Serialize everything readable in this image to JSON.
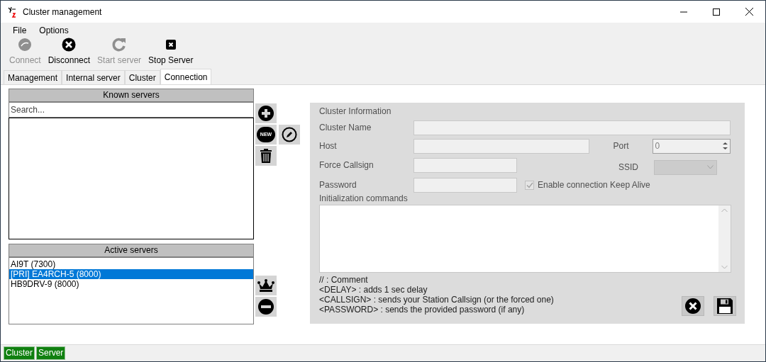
{
  "window": {
    "title": "Cluster management"
  },
  "menu": [
    "File",
    "Options"
  ],
  "toolbar": [
    {
      "label": "Connect",
      "kind": "connect",
      "disabled": true
    },
    {
      "label": "Disconnect",
      "kind": "disconnect",
      "disabled": false
    },
    {
      "label": "Start server",
      "kind": "start",
      "disabled": true
    },
    {
      "label": "Stop Server",
      "kind": "stop",
      "disabled": false
    }
  ],
  "tabs": [
    {
      "label": "Management",
      "selected": false
    },
    {
      "label": "Internal server",
      "selected": false
    },
    {
      "label": "Cluster",
      "selected": false
    },
    {
      "label": "Connection",
      "selected": true
    }
  ],
  "known_servers": {
    "title": "Known servers",
    "search": {
      "placeholder": "Search..."
    },
    "new_badge": "NEW"
  },
  "active_servers": {
    "title": "Active servers",
    "items": [
      {
        "label": "AI9T (7300)",
        "selected": false
      },
      {
        "label": "[PRI] EA4RCH-5 (8000)",
        "selected": true
      },
      {
        "label": "HB9DRV-9 (8000)",
        "selected": false
      }
    ]
  },
  "cluster_info": {
    "title": "Cluster Information",
    "cluster_name": {
      "label": "Cluster Name"
    },
    "host": {
      "label": "Host"
    },
    "port": {
      "label": "Port",
      "value": "0"
    },
    "force_callsign": {
      "label": "Force Callsign"
    },
    "ssid": {
      "label": "SSID"
    },
    "password": {
      "label": "Password"
    },
    "keep_alive": {
      "label": "Enable connection Keep Alive",
      "checked": true
    },
    "init_commands": {
      "label": "Initialization commands"
    },
    "help": [
      "// : Comment",
      "<DELAY> : adds 1 sec delay",
      "<CALLSIGN> : sends your Station Callsign (or the forced one)",
      "<PASSWORD> : sends the provided password (if any)"
    ]
  },
  "status_bar": [
    "Cluster",
    "Server"
  ]
}
